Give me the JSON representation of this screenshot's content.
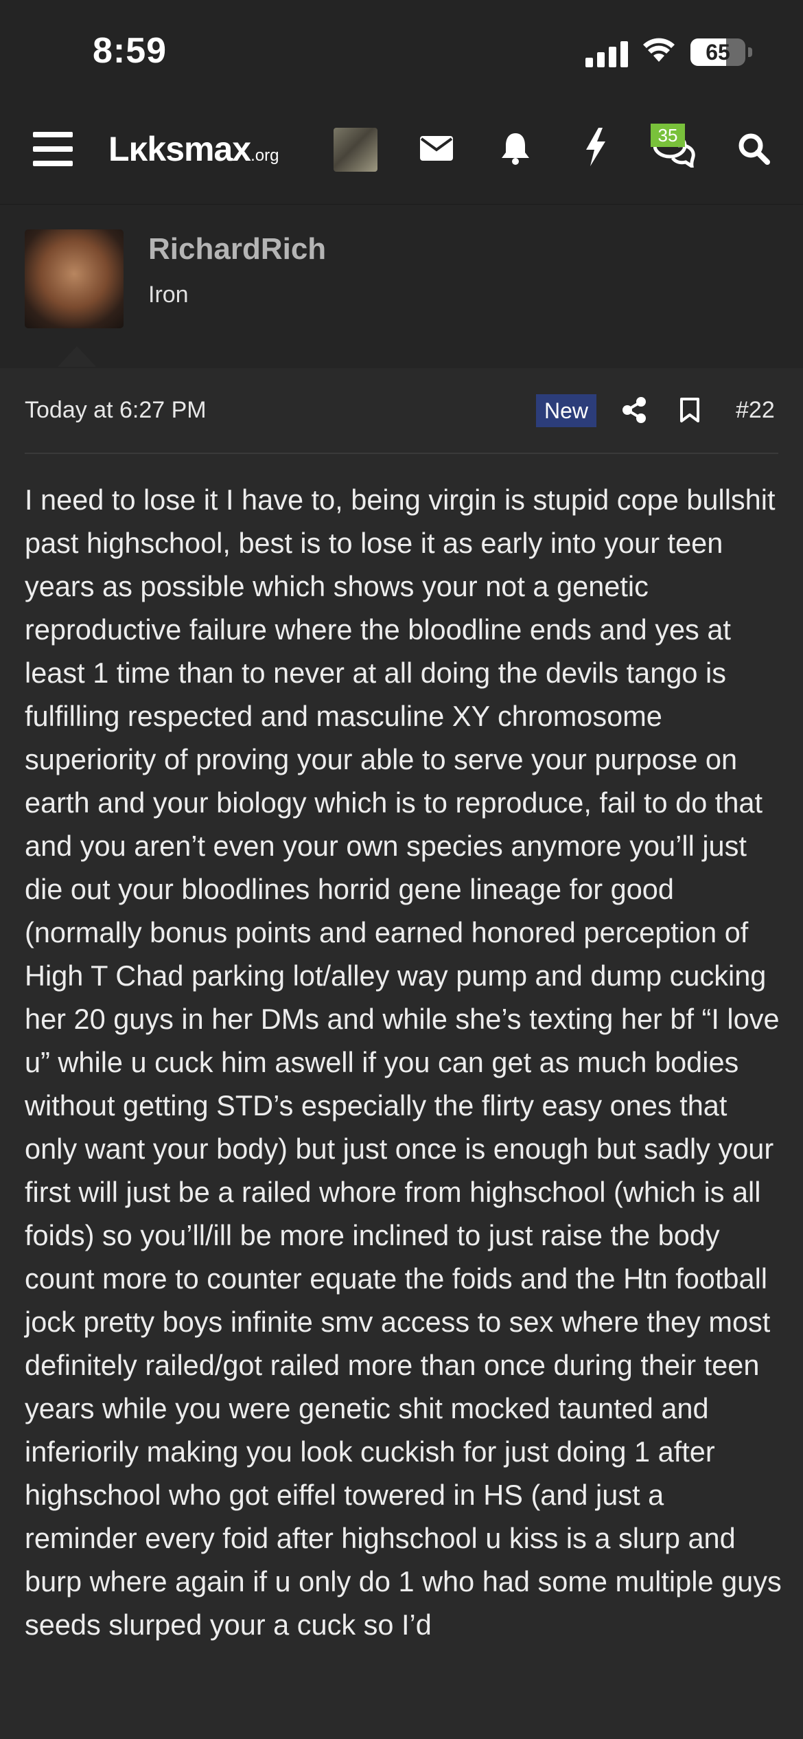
{
  "status_bar": {
    "time": "8:59",
    "battery": "65",
    "battery_level_percent": 65
  },
  "nav": {
    "logo_main": "Lκksmax",
    "logo_suffix": ".org",
    "chat_badge": "35",
    "icons": [
      "menu-icon",
      "user-avatar",
      "mail-icon",
      "bell-icon",
      "bolt-icon",
      "chat-icon",
      "search-icon"
    ],
    "badge_color": "#79c13b"
  },
  "post": {
    "username": "RichardRich",
    "user_title": "Iron",
    "timestamp": "Today at 6:27 PM",
    "new_label": "New",
    "post_number": "#22",
    "new_badge_color": "#2c3d7a",
    "message": "I need to lose it I have to, being virgin is stupid cope bullshit past highschool, best is to lose it as early into your teen years as possible which shows your not a genetic reproductive failure where the bloodline ends and yes at least 1 time than to never at all doing the devils tango is fulfilling respected and masculine XY chromosome superiority of proving your able to serve your purpose on earth and your biology which is to reproduce, fail to do that and you aren’t even your own species anymore you’ll just die out your bloodlines horrid gene lineage for good (normally bonus points and earned honored perception of High T Chad parking lot/alley way pump and dump cucking her 20 guys in her DMs and while she’s texting her bf “I love u” while u cuck him aswell if you can get as much bodies without getting STD’s especially the flirty easy ones that only want your body) but just once is enough but sadly your first will just be a railed whore from highschool (which is all foids) so you’ll/ill be more inclined to just raise the body count more to counter equate the foids and the Htn football jock pretty boys infinite smv access to sex where they most definitely railed/got railed more than once during their teen years while you were genetic shit mocked taunted and inferiorily making you look cuckish for just doing 1 after highschool who got eiffel towered in HS (and just a reminder every foid after highschool u kiss is a slurp and burp where again if u only do 1 who had some multiple guys seeds slurped your a cuck so I’d"
  }
}
